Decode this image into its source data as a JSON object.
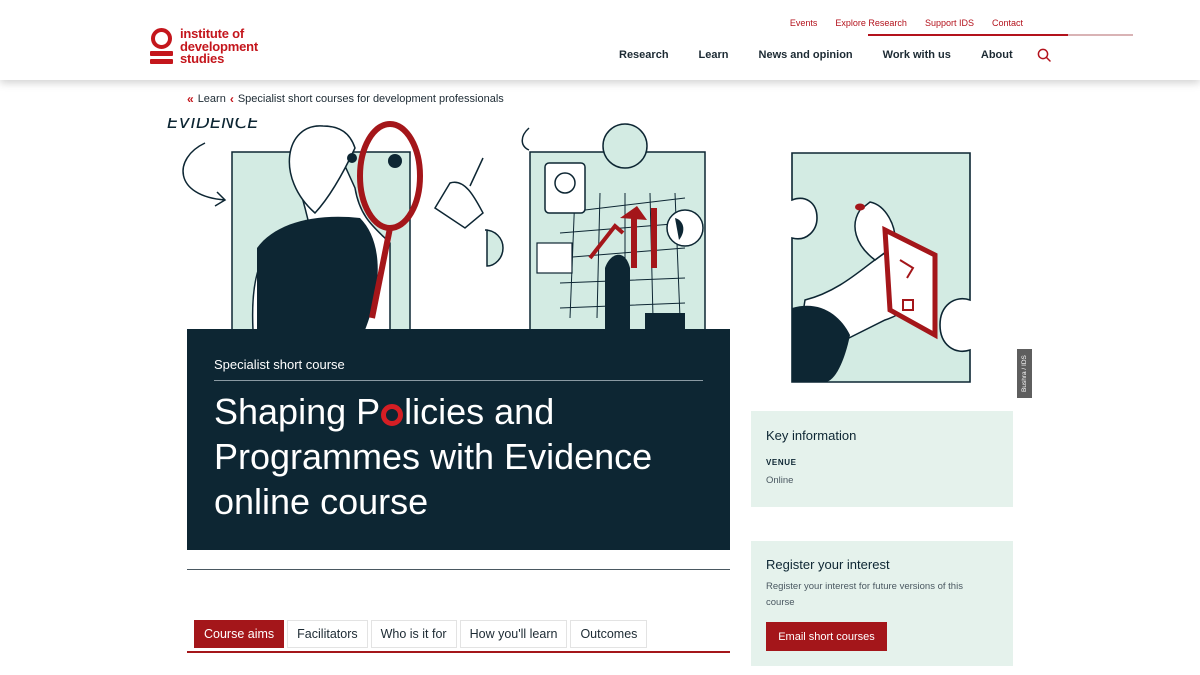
{
  "logo": {
    "line1": "institute of",
    "line2": "development",
    "line3": "studies"
  },
  "util_nav": [
    "Events",
    "Explore Research",
    "Support IDS",
    "Contact"
  ],
  "main_nav": [
    "Research",
    "Learn",
    "News and opinion",
    "Work with us",
    "About"
  ],
  "breadcrumb": {
    "item1": "Learn",
    "item2": "Specialist short courses for development professionals"
  },
  "hero": {
    "art_text": "EVIDENCE",
    "kicker": "Specialist short course",
    "title_pre": "Shaping P",
    "title_post": "licies and Programmes with Evidence online course"
  },
  "credit": "Bushra / IDS",
  "key_info": {
    "heading": "Key information",
    "venue_label": "VENUE",
    "venue_value": "Online"
  },
  "register": {
    "heading": "Register your interest",
    "text": "Register your interest for future versions of this course",
    "button": "Email short courses"
  },
  "tabs": [
    {
      "label": "Course aims",
      "active": true
    },
    {
      "label": "Facilitators",
      "active": false
    },
    {
      "label": "Who is it for",
      "active": false
    },
    {
      "label": "How you'll learn",
      "active": false
    },
    {
      "label": "Outcomes",
      "active": false
    }
  ],
  "colors": {
    "brand_red": "#c4161c",
    "dark_navy": "#0d2633",
    "mint": "#e5f2ec"
  }
}
